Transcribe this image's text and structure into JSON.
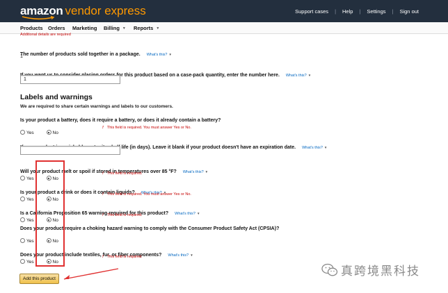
{
  "header": {
    "logo_amazon": "amazon",
    "logo_product": "vendor express",
    "links": [
      "Support cases",
      "Help",
      "Settings",
      "Sign out"
    ]
  },
  "nav": {
    "items": [
      "Products",
      "Orders",
      "Marketing",
      "Billing",
      "Reports"
    ]
  },
  "cutoff_notice": "Additional details are required",
  "whats_this": "What's this?",
  "package": {
    "question": "The number of products sold together in a package.",
    "value": "1"
  },
  "case_pack": {
    "question": "If you want us to consider placing orders for this product based on a case-pack quantity, enter the number here.",
    "value": "1"
  },
  "labels_section": {
    "title": "Labels and warnings",
    "subtitle": "We are required to share certain warnings and labels to our customers."
  },
  "radio_labels": {
    "yes": "Yes",
    "no": "No"
  },
  "battery": {
    "question": "Is your product a battery, does it require a battery, or does it already contain a battery?",
    "error": "This field is required. You must answer Yes or No.",
    "selected": "No"
  },
  "perishable": {
    "question": "If your product is perishable, enter its shelf life (in days). Leave it blank if your product doesn't have an expiration date.",
    "value": ""
  },
  "melt": {
    "question": "Will your product melt or spoil if stored in temperatures over 85 °F?",
    "error": "This field is required.",
    "selected": "No"
  },
  "drink": {
    "question": "Is your product a drink or does it contain liquids?",
    "error": "This field is required. You must answer Yes or No.",
    "selected": "No"
  },
  "prop65": {
    "question": "Is a California Proposition 65 warning required for this product?",
    "error": "This field is required.",
    "selected": "No"
  },
  "choking": {
    "question": "Does your product require a choking hazard warning to comply with the Consumer Product Safety Act (CPSIA)?",
    "selected": "No"
  },
  "textiles": {
    "question": "Does your product include textiles, fur, or fiber components?",
    "error": "This field is required.",
    "selected": "No"
  },
  "add_button": "Add this product",
  "watermark": "真跨境黑科技",
  "colors": {
    "header_bg": "#232f3e",
    "brand_orange": "#ff9900",
    "error_red": "#c40000",
    "link_blue": "#0066c0",
    "annotation_red": "#e03030",
    "button_yellow": "#f0c14b"
  }
}
